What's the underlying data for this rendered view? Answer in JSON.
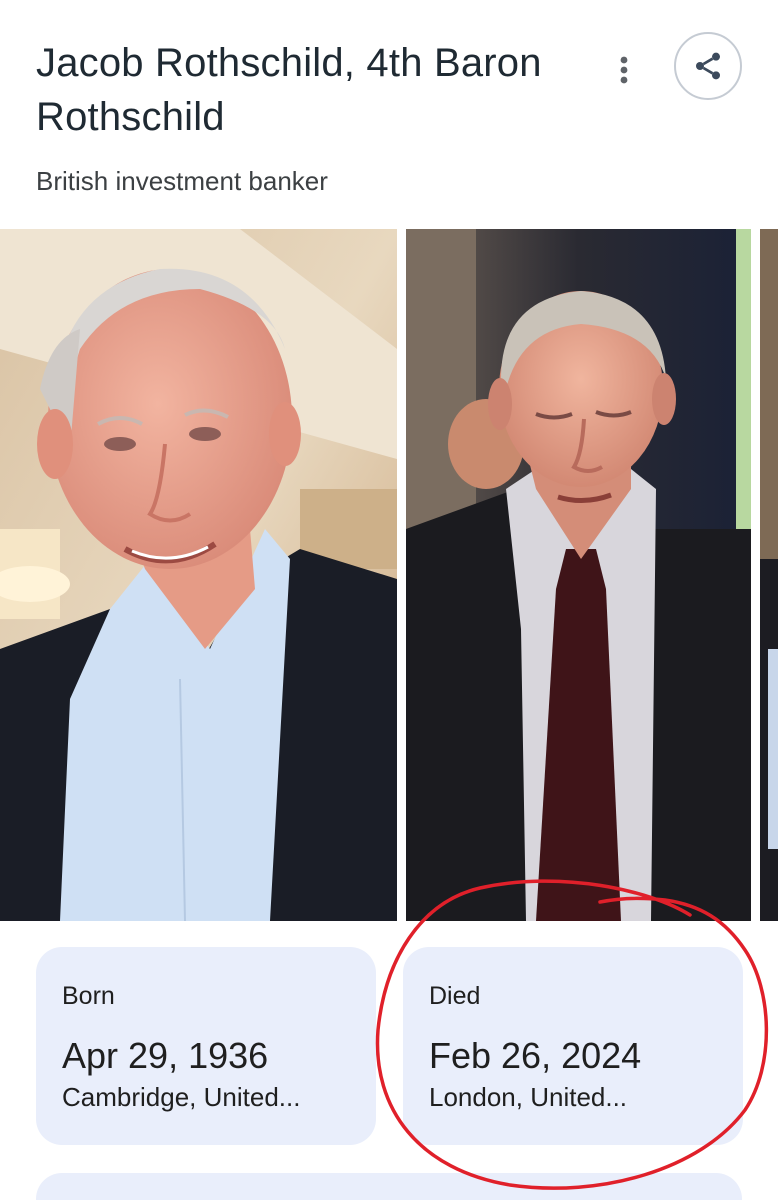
{
  "header": {
    "title": "Jacob Rothschild, 4th Baron Rothschild",
    "subtitle": "British investment banker",
    "more_icon": "more-vert-icon",
    "share_icon": "share-icon"
  },
  "gallery": {
    "images": [
      {
        "subject": "portrait-photo"
      },
      {
        "subject": "portrait-photo"
      },
      {
        "subject": "portrait-photo"
      }
    ]
  },
  "facts": {
    "born": {
      "label": "Born",
      "date": "Apr 29, 1936",
      "place": "Cambridge, United..."
    },
    "died": {
      "label": "Died",
      "date": "Feb 26, 2024",
      "place": "London, United..."
    }
  },
  "colors": {
    "accent_ring": "#e0202a",
    "card_bg": "#e9eefb",
    "title_text": "#1f2a33"
  }
}
